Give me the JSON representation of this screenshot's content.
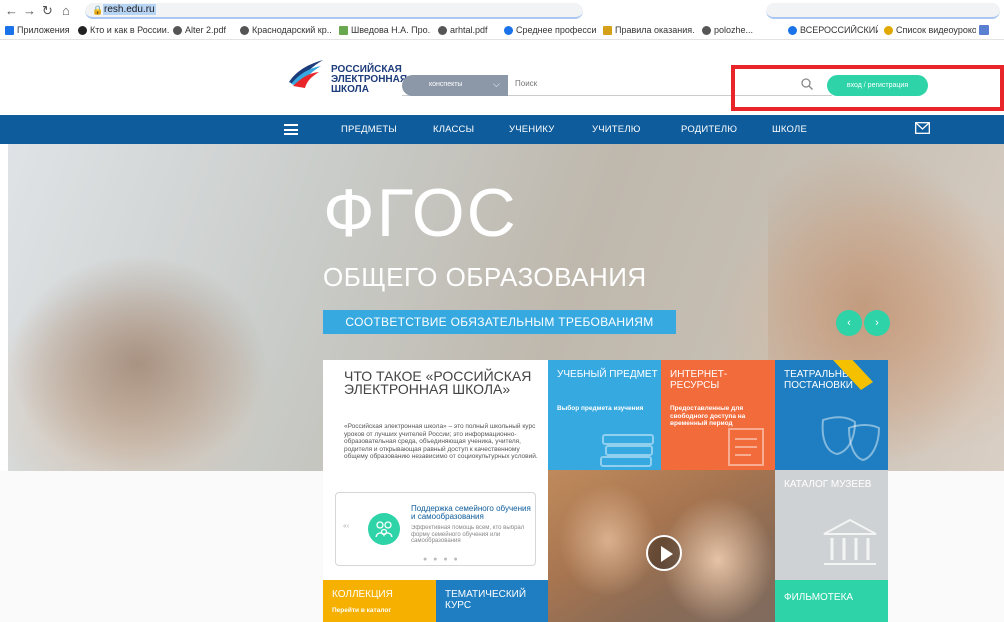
{
  "browser": {
    "url": "resh.edu.ru"
  },
  "bookmarks": [
    {
      "label": "Приложения",
      "color": "#1a73e8"
    },
    {
      "label": "Кто и как в России...",
      "color": "#222222"
    },
    {
      "label": "Alter 2.pdf",
      "color": "#555555"
    },
    {
      "label": "Краснодарский кр...",
      "color": "#555555"
    },
    {
      "label": "Шведова Н.А. Про...",
      "color": "#6aa84f"
    },
    {
      "label": "arhtal.pdf",
      "color": "#555555"
    },
    {
      "label": "Среднее професси...",
      "color": "#1a73e8"
    },
    {
      "label": "Правила оказания...",
      "color": "#d4a017"
    },
    {
      "label": "polozhe...",
      "color": "#555555"
    },
    {
      "label": "ВСЕРОССИЙСКИЙ...",
      "color": "#1a73e8"
    },
    {
      "label": "Список видеоуроков...",
      "color": "#e0a800"
    }
  ],
  "header": {
    "logo_line1": "РОССИЙСКАЯ",
    "logo_line2": "ЭЛЕКТРОННАЯ",
    "logo_line3": "ШКОЛА",
    "search_category": "конспекты",
    "search_placeholder": "Поиск",
    "login_label": "вход / регистрация"
  },
  "nav": {
    "items": [
      "ПРЕДМЕТЫ",
      "КЛАССЫ",
      "УЧЕНИКУ",
      "УЧИТЕЛЮ",
      "РОДИТЕЛЮ",
      "ШКОЛЕ"
    ]
  },
  "hero": {
    "title": "ФГОС",
    "subtitle": "ОБЩЕГО ОБРАЗОВАНИЯ",
    "badge": "СООТВЕТСТВИЕ ОБЯЗАТЕЛЬНЫМ ТРЕБОВАНИЯМ",
    "prev_arrow": "‹",
    "next_arrow": "›"
  },
  "about": {
    "title": "ЧТО ТАКОЕ «РОССИЙСКАЯ ЭЛЕКТРОННАЯ ШКОЛА»",
    "text": "«Российская электронная школа» – это полный школьный курс уроков от лучших учителей России; это информационно-образовательная среда, объединяющая ученика, учителя, родителя и открывающая равный доступ к качественному общему образованию независимо от социокультурных условий.",
    "support_prev": "«‹",
    "support_title": "Поддержка семейного обучения и самообразования",
    "support_text": "Эффективная помощь всем, кто выбрал форму семейного обучения или самообразования",
    "dots": "● ● ● ●"
  },
  "tiles": {
    "subject_title": "УЧЕБНЫЙ ПРЕДМЕТ",
    "subject_sub": "Выбор предмета изучения",
    "subject_color": "#36a9e1",
    "internet_title": "ИНТЕРНЕТ-РЕСУРСЫ",
    "internet_sub": "Предоставленные для свободного доступа на временный период",
    "internet_color": "#f26b3a",
    "theatre_title": "ТЕАТРАЛЬНЫЕ ПОСТАНОВКИ",
    "theatre_color": "#1e7ec1",
    "museum_title": "КАТАЛОГ МУЗЕЕВ",
    "museum_color": "#cfd2d4",
    "collection_title": "КОЛЛЕКЦИЯ",
    "collection_sub": "Перейти в каталог",
    "collection_color": "#f5b000",
    "thematic_title": "ТЕМАТИЧЕСКИЙ КУРС",
    "thematic_color": "#1e7ec1",
    "film_title": "ФИЛЬМОТЕКА",
    "film_color": "#2ed3a8"
  }
}
